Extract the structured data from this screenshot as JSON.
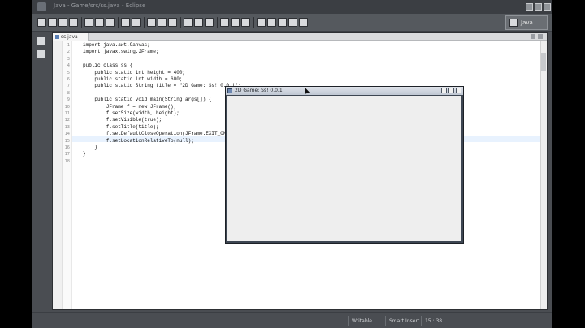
{
  "window": {
    "title": "Java - Game/src/ss.java - Eclipse"
  },
  "perspective": {
    "label": "Java"
  },
  "editor": {
    "tab_label": "ss.java",
    "line_numbers": [
      "1",
      "2",
      "3",
      "4",
      "5",
      "6",
      "7",
      "8",
      "9",
      "10",
      "11",
      "12",
      "13",
      "14",
      "15",
      "16",
      "17",
      "18"
    ],
    "lines": [
      "import java.awt.Canvas;",
      "import javax.swing.JFrame;",
      "",
      "public class ss {",
      "    public static int height = 400;",
      "    public static int width = 600;",
      "    public static String title = \"2D Game: Ss! 0.0.1\";",
      "",
      "    public static void main(String args[]) {",
      "        JFrame f = new JFrame();",
      "        f.setSize(width, height);",
      "        f.setVisible(true);",
      "        f.setTitle(title);",
      "        f.setDefaultCloseOperation(JFrame.EXIT_ON_CLOSE);",
      "        f.setLocationRelativeTo(null);",
      "    }",
      "}",
      ""
    ]
  },
  "jframe": {
    "title": "2D Game: Ss! 0.0.1"
  },
  "status": {
    "writable": "Writable",
    "insert_mode": "Smart Insert",
    "position": "15 : 38"
  },
  "colors": {
    "keyword": "#7f0055",
    "string": "#2a00ff",
    "highlight": "#e8f2fe"
  }
}
